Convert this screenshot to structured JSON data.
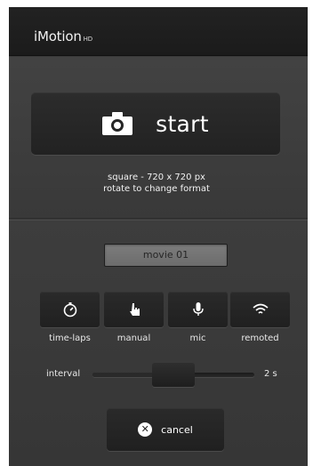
{
  "header": {
    "brand": "iMotion",
    "brand_suffix": "HD"
  },
  "start": {
    "label": "start",
    "icon": "camera-icon"
  },
  "format": {
    "line1": "square - 720 x 720 px",
    "line2": "rotate to change format"
  },
  "movie_name": {
    "value": "movie 01"
  },
  "modes": [
    {
      "label": "time-laps",
      "icon": "stopwatch-icon"
    },
    {
      "label": "manual",
      "icon": "hand-pointer-icon"
    },
    {
      "label": "mic",
      "icon": "microphone-icon"
    },
    {
      "label": "remoted",
      "icon": "wifi-icon"
    }
  ],
  "interval": {
    "label": "interval",
    "value_label": "2 s",
    "level": 0.5
  },
  "cancel": {
    "label": "cancel",
    "icon": "close-circle-icon"
  },
  "colors": {
    "background": "#3a3a3a",
    "button": "#242424",
    "text": "#ffffff",
    "field": "#747474"
  }
}
